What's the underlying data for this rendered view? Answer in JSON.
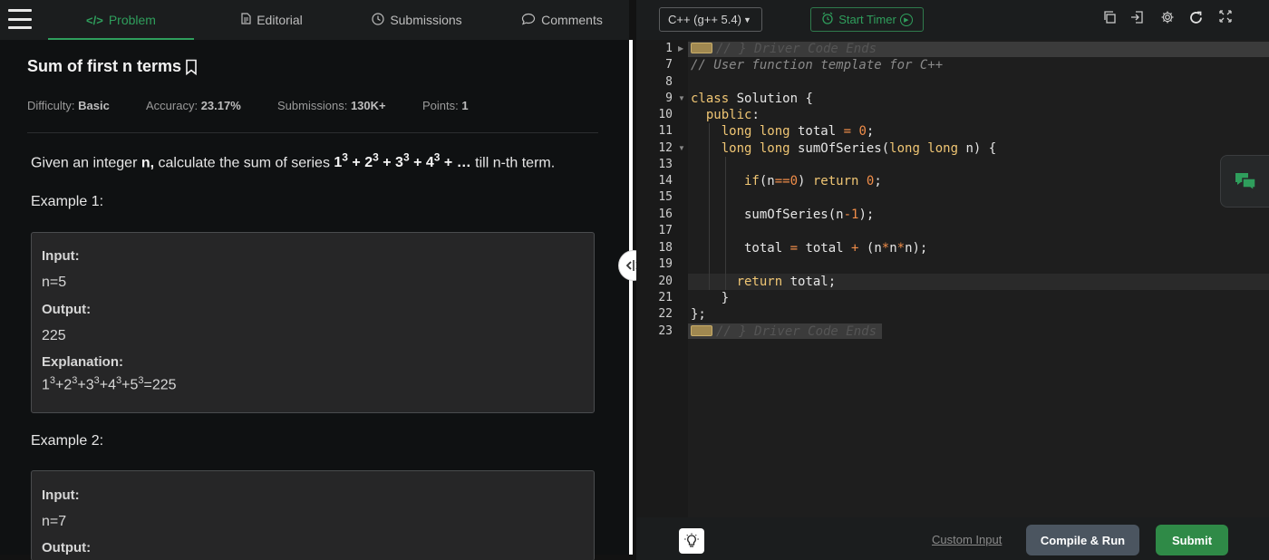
{
  "nav": {
    "tabs": [
      {
        "label": "Problem",
        "icon": "code-icon"
      },
      {
        "label": "Editorial",
        "icon": "document-icon"
      },
      {
        "label": "Submissions",
        "icon": "clock-icon"
      },
      {
        "label": "Comments",
        "icon": "chat-bubble-icon"
      }
    ],
    "active_tab": "Problem"
  },
  "problem": {
    "title": "Sum of first n terms",
    "meta": {
      "difficulty_label": "Difficulty:",
      "difficulty": "Basic",
      "accuracy_label": "Accuracy:",
      "accuracy": "23.17%",
      "submissions_label": "Submissions:",
      "submissions": "130K+",
      "points_label": "Points:",
      "points": "1"
    },
    "desc": {
      "pre": "Given an integer ",
      "n": "n,",
      "mid": " calculate the sum of series ",
      "post": " till n-th term."
    },
    "example1": {
      "heading": "Example 1:",
      "input_label": "Input:",
      "input": "n=5",
      "output_label": "Output:",
      "output": "225",
      "explanation_label": "Explanation:",
      "explanation_end": "=225"
    },
    "example2": {
      "heading": "Example 2:",
      "input_label": "Input:",
      "input": "n=7",
      "output_label": "Output:"
    }
  },
  "editor": {
    "language": "C++ (g++ 5.4)",
    "timer_label": "Start Timer",
    "folded_text": "// } Driver Code Ends",
    "line_numbers": [
      "1",
      "7",
      "8",
      "9",
      "10",
      "11",
      "12",
      "13",
      "14",
      "15",
      "16",
      "17",
      "18",
      "19",
      "20",
      "21",
      "22",
      "23"
    ],
    "comment_line": "// User function template for C++",
    "custom_input": "Custom Input",
    "compile_run": "Compile & Run",
    "submit": "Submit"
  },
  "colors": {
    "accent": "#2f9e5c",
    "keyword": "#f0c674",
    "number": "#f08d49",
    "compile_bg": "#4b5560",
    "submit_bg": "#2f8a47"
  }
}
